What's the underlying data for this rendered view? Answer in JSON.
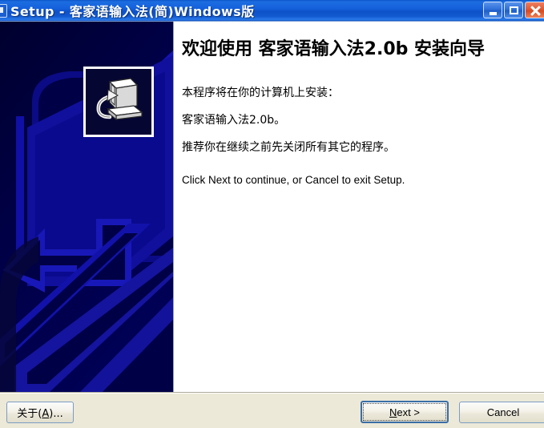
{
  "window": {
    "title": "Setup - 客家语输入法(简)Windows版",
    "icon": "setup-window-icon",
    "buttons": {
      "minimize": "minimize-icon",
      "maximize": "maximize-icon",
      "close": "close-icon"
    }
  },
  "colors": {
    "titlebar_blue": "#1561dd",
    "panel_navy": "#000046",
    "panel_accent_blue": "#0000cc",
    "content_bg": "#ffffff",
    "footer_bg": "#ece9d8",
    "close_red": "#e15a33",
    "default_button_border": "#3a6ea5"
  },
  "side_panel": {
    "icon_name": "computer-setup-icon",
    "artwork_name": "blue-arrow-artwork"
  },
  "content": {
    "heading": "欢迎使用 客家语输入法2.0b 安装向导",
    "lines": [
      "本程序将在你的计算机上安装：",
      "客家语输入法2.0b。",
      "推荐你在继续之前先关闭所有其它的程序。",
      "Click Next to continue, or Cancel to exit Setup."
    ]
  },
  "footer": {
    "about_label_prefix": "关于(",
    "about_accel": "A",
    "about_label_suffix": ")...",
    "next_accel": "N",
    "next_label_suffix": "ext >",
    "cancel_label": "Cancel"
  }
}
